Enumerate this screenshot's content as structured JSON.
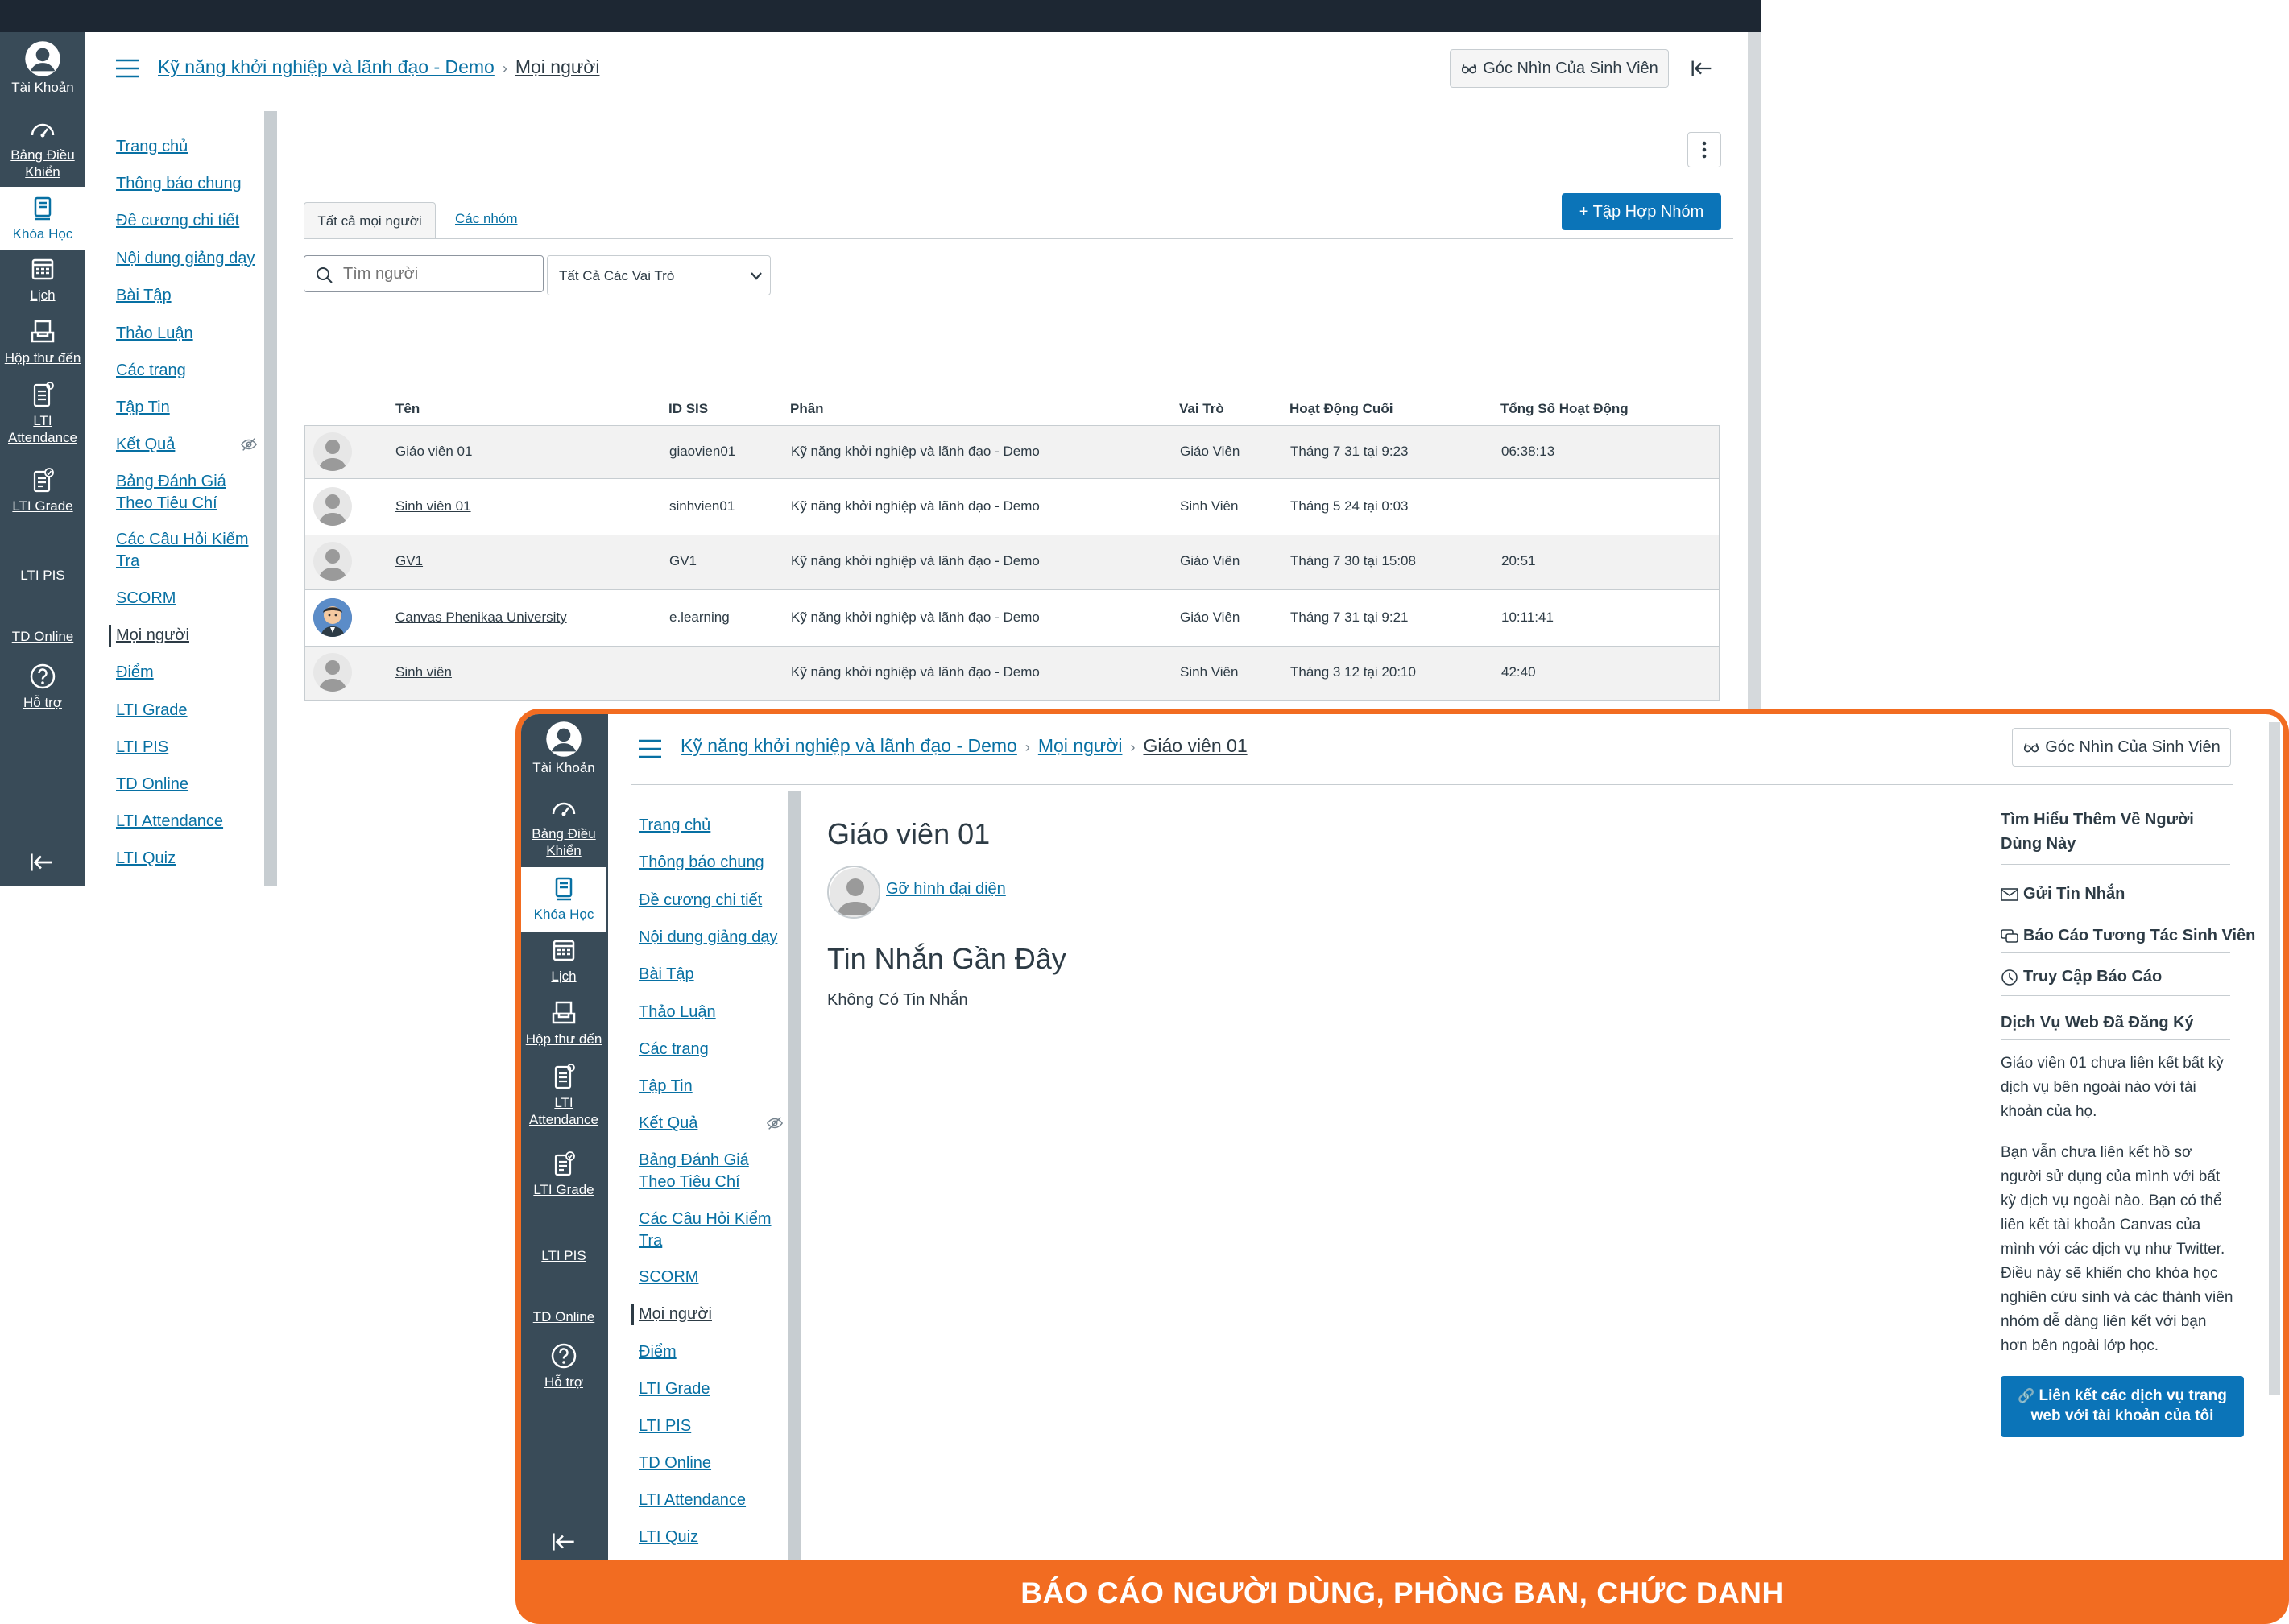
{
  "colors": {
    "accent": "#0770a3",
    "nav_bg": "#394b58",
    "topbar": "#1d2733",
    "primary_btn": "#0b74b8",
    "frame": "#f26c21"
  },
  "global_nav": [
    {
      "label": "Tài Khoản",
      "icon": "account-avatar-icon"
    },
    {
      "label": "Bảng Điều Khiển",
      "icon": "dashboard-gauge-icon"
    },
    {
      "label": "Khóa Học",
      "icon": "courses-book-icon"
    },
    {
      "label": "Lịch",
      "icon": "calendar-icon"
    },
    {
      "label": "Hộp thư đến",
      "icon": "inbox-icon"
    },
    {
      "label": "LTI Attendance",
      "icon": "lti-attendance-icon"
    },
    {
      "label": "LTI Grade",
      "icon": "lti-grade-icon"
    },
    {
      "label": "LTI PIS",
      "icon": ""
    },
    {
      "label": "TD Online",
      "icon": ""
    },
    {
      "label": "Hỗ trợ",
      "icon": "help-question-icon"
    }
  ],
  "course_nav": [
    "Trang chủ",
    "Thông báo chung",
    "Đề cương chi tiết",
    "Nội dung giảng dạy",
    "Bài Tập",
    "Thảo Luận",
    "Các trang",
    "Tập Tin",
    "Kết Quả",
    "Bảng Đánh Giá Theo Tiêu Chí",
    "Các Câu Hỏi Kiểm Tra",
    "SCORM",
    "Mọi người",
    "Điểm",
    "LTI Grade",
    "LTI PIS",
    "TD Online",
    "LTI Attendance",
    "LTI Quiz"
  ],
  "people_page": {
    "breadcrumb": [
      "Kỹ năng khởi nghiệp và lãnh đạo - Demo",
      "Mọi người"
    ],
    "student_view": "Góc Nhìn Của Sinh Viên",
    "tabs": [
      "Tất cả mọi người",
      "Các nhóm"
    ],
    "add_group_button": "+ Tập Hợp Nhóm",
    "search_placeholder": "Tìm người",
    "role_filter": "Tất Cả Các Vai Trò",
    "columns": [
      "Tên",
      "ID SIS",
      "Phần",
      "Vai Trò",
      "Hoạt Động Cuối",
      "Tổng Số Hoạt Động"
    ],
    "rows": [
      {
        "name": "Giáo viên 01",
        "sis": "giaovien01",
        "section": "Kỹ năng khởi nghiệp và lãnh đạo - Demo",
        "role": "Giáo Viên",
        "last": "Tháng 7 31 tại 9:23",
        "total": "06:38:13"
      },
      {
        "name": "Sinh viên 01",
        "sis": "sinhvien01",
        "section": "Kỹ năng khởi nghiệp và lãnh đạo - Demo",
        "role": "Sinh Viên",
        "last": "Tháng 5 24 tại 0:03",
        "total": ""
      },
      {
        "name": "GV1",
        "sis": "GV1",
        "section": "Kỹ năng khởi nghiệp và lãnh đạo - Demo",
        "role": "Giáo Viên",
        "last": "Tháng 7 30 tại 15:08",
        "total": "20:51"
      },
      {
        "name": "Canvas Phenikaa University",
        "sis": "e.learning",
        "section": "Kỹ năng khởi nghiệp và lãnh đạo - Demo",
        "role": "Giáo Viên",
        "last": "Tháng 7 31 tại 9:21",
        "total": "10:11:41"
      },
      {
        "name": "Sinh viên",
        "sis": "",
        "section": "Kỹ năng khởi nghiệp và lãnh đạo - Demo",
        "role": "Sinh Viên",
        "last": "Tháng 3 12 tại 20:10",
        "total": "42:40"
      }
    ]
  },
  "profile_page": {
    "breadcrumb": [
      "Kỹ năng khởi nghiệp và lãnh đạo - Demo",
      "Mọi người",
      "Giáo viên 01"
    ],
    "student_view": "Góc Nhìn Của Sinh Viên",
    "name": "Giáo viên 01",
    "remove_avatar": "Gỡ hình đại diện",
    "recent_messages_title": "Tin Nhắn Gần Đây",
    "no_messages": "Không Có Tin Nhắn",
    "side_title": "Tìm Hiểu Thêm Về Người Dùng Này",
    "send_message": "Gửi Tin Nhắn",
    "interaction_report": "Báo Cáo Tương Tác Sinh Viên",
    "access_report": "Truy Cập Báo Cáo",
    "web_services_title": "Dịch Vụ Web Đã Đăng Ký",
    "web_services_text1": "Giáo viên 01 chưa liên kết bất kỳ dịch vụ bên ngoài nào với tài khoản của họ.",
    "web_services_text2": "Bạn vẫn chưa liên kết hồ sơ người sử dụng của mình với bất kỳ dịch vụ ngoài nào. Bạn có thể liên kết tài khoản Canvas của mình với các dịch vụ như Twitter. Điều này sẽ khiến cho khóa học nghiên cứu sinh và các thành viên nhóm dễ dàng liên kết với bạn hơn bên ngoài lớp học.",
    "link_services_button": "Liên kết các dịch vụ trang web với tài khoản của tôi"
  },
  "banner": "BÁO CÁO NGƯỜI DÙNG, PHÒNG BAN, CHỨC DANH"
}
